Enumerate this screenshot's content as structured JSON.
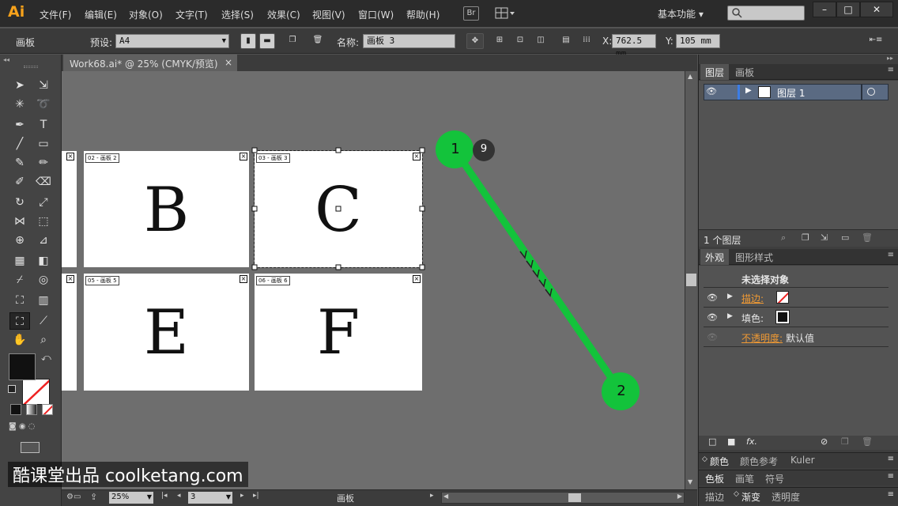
{
  "app": {
    "logo": "Ai"
  },
  "menu": {
    "items": [
      "文件(F)",
      "编辑(E)",
      "对象(O)",
      "文字(T)",
      "选择(S)",
      "效果(C)",
      "视图(V)",
      "窗口(W)",
      "帮助(H)"
    ],
    "bridge": "Br",
    "workspace": "基本功能",
    "window_buttons": [
      "–",
      "□",
      "✕"
    ]
  },
  "control": {
    "context": "画板",
    "preset_label": "预设:",
    "preset_value": "A4",
    "name_label": "名称:",
    "name_value": "画板 3",
    "x_label": "X:",
    "x_value": "762.5 mm",
    "y_label": "Y:",
    "y_value": "105 mm"
  },
  "document": {
    "tab_title": "Work68.ai* @ 25% (CMYK/预览)",
    "close": "×"
  },
  "artboards": [
    {
      "label": "02 - 画板 2",
      "letter": "B"
    },
    {
      "label": "03 - 画板 3",
      "letter": "C"
    },
    {
      "label": "05 - 画板 5",
      "letter": "E"
    },
    {
      "label": "06 - 画板 6",
      "letter": "F"
    }
  ],
  "gesture": {
    "start_label": "1",
    "end_label": "2",
    "count_badge": "9",
    "color": "#13c33b"
  },
  "status": {
    "zoom": "25%",
    "page": "3",
    "mode": "画板"
  },
  "layers_panel": {
    "tabs": [
      "图层",
      "画板"
    ],
    "layer_name": "图层 1",
    "footer": "1 个图层"
  },
  "appearance_panel": {
    "tabs": [
      "外观",
      "图形样式"
    ],
    "header": "未选择对象",
    "stroke_label": "描边:",
    "fill_label": "填色:",
    "opacity_label": "不透明度:",
    "opacity_value": "默认值",
    "fx": "fx."
  },
  "bottom_panels": {
    "row1": [
      "颜色",
      "颜色参考",
      "Kuler"
    ],
    "row2": [
      "色板",
      "画笔",
      "符号"
    ],
    "row3": [
      "描边",
      "渐变",
      "透明度"
    ]
  },
  "watermark": "酷课堂出品 coolketang.com"
}
